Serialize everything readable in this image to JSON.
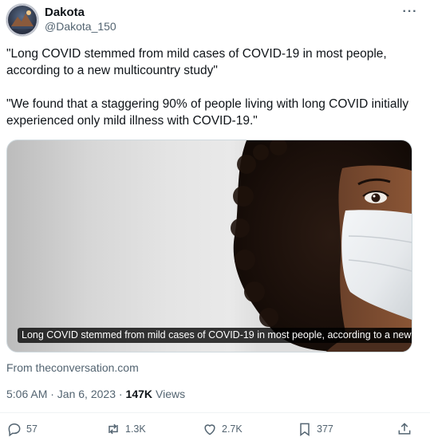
{
  "author": {
    "name": "Dakota",
    "handle": "@Dakota_150"
  },
  "tweet": {
    "paragraphs": [
      "\"Long COVID stemmed from mild cases of COVID-19 in most people, according to a new multicountry study\"",
      "\"We found that a staggering 90% of people living with long COVID initially experienced only mild illness with COVID-19.\""
    ],
    "media_caption": "Long COVID stemmed from mild cases of COVID-19 in most people, according to a new ...",
    "source": "From theconversation.com",
    "timestamp": "5:06 AM · Jan 6, 2023 ·",
    "views_count": "147K",
    "views_label": "Views"
  },
  "actions": {
    "replies": "57",
    "reposts": "1.3K",
    "likes": "2.7K",
    "bookmarks": "377"
  },
  "icons": {
    "more": "more-options-icon",
    "reply": "reply-icon",
    "repost": "repost-icon",
    "like": "heart-icon",
    "bookmark": "bookmark-icon",
    "share": "share-icon"
  },
  "colors": {
    "text": "#0f1419",
    "secondary": "#536471",
    "border": "#cfd9de"
  }
}
